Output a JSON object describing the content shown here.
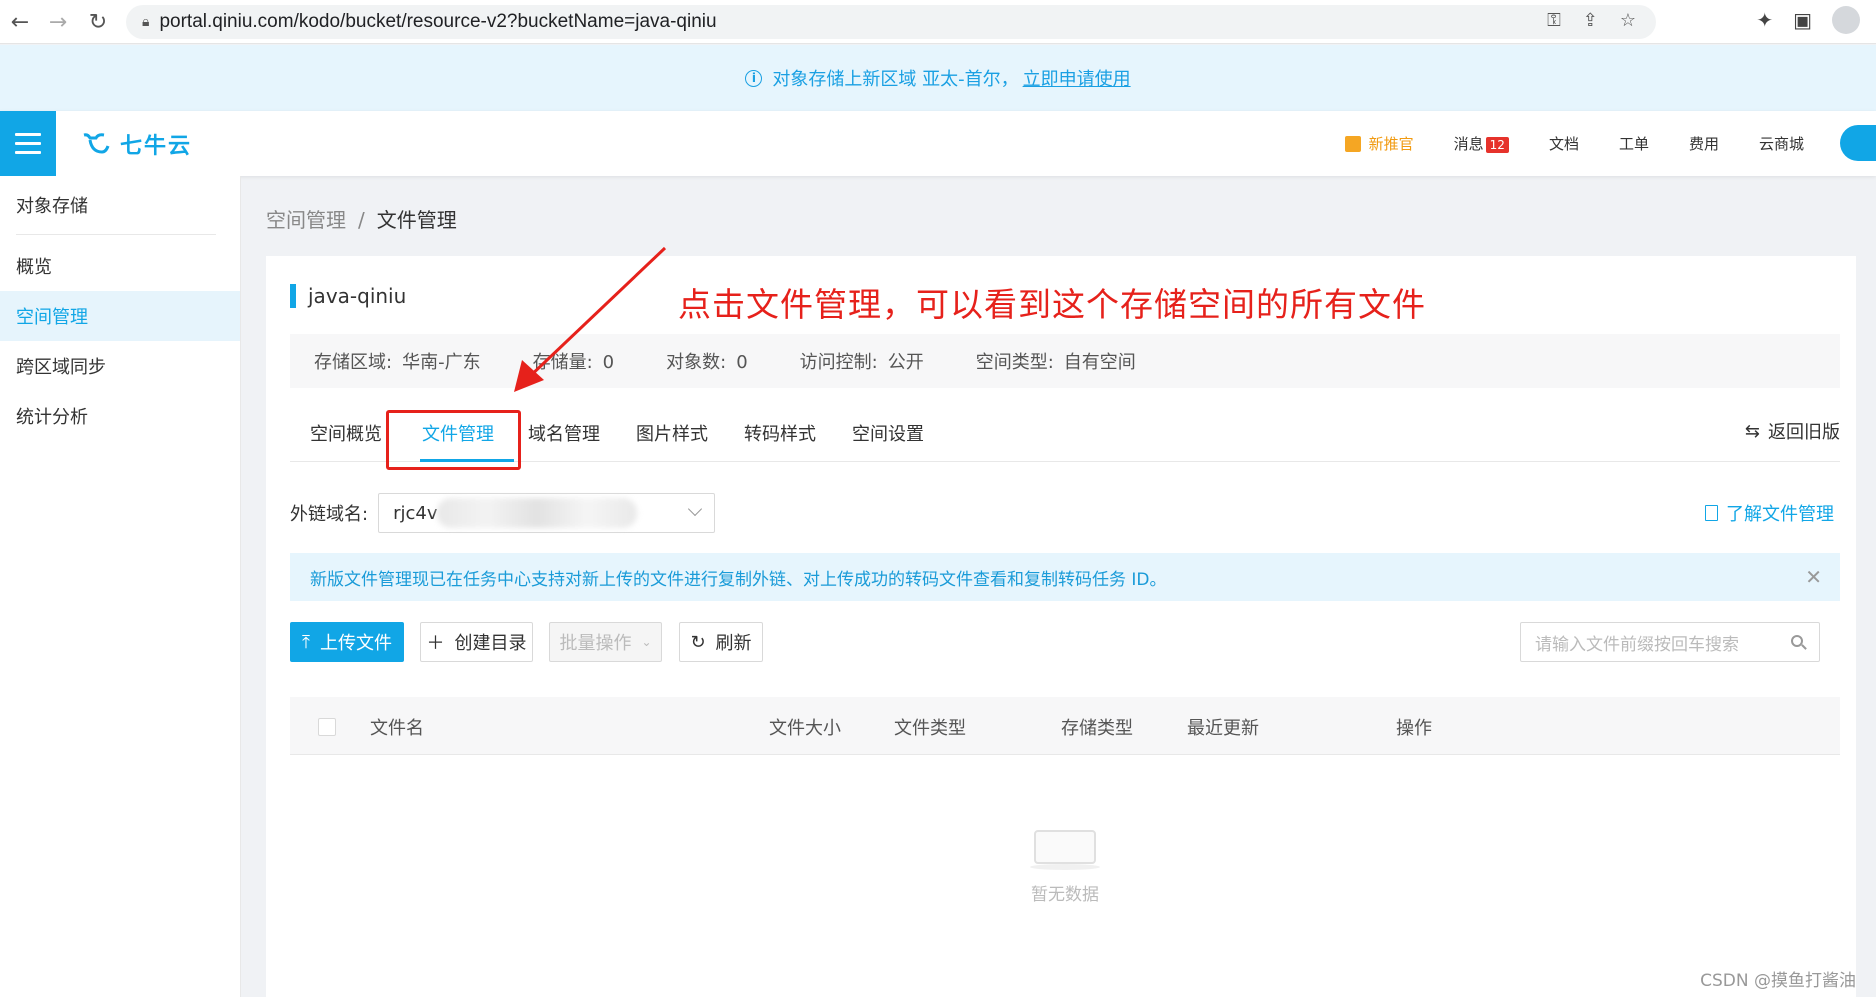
{
  "browser": {
    "url": "portal.qiniu.com/kodo/bucket/resource-v2?bucketName=java-qiniu"
  },
  "notice": {
    "text": "对象存储上新区域 亚太-首尔，",
    "link": "立即申请使用"
  },
  "header": {
    "logo": "七牛云",
    "nav": [
      "新推官",
      "消息",
      "文档",
      "工单",
      "费用",
      "云商城"
    ],
    "message_count": "12"
  },
  "sidebar": {
    "title": "对象存储",
    "items": [
      {
        "label": "概览",
        "active": false
      },
      {
        "label": "空间管理",
        "active": true
      },
      {
        "label": "跨区域同步",
        "active": false
      },
      {
        "label": "统计分析",
        "active": false
      }
    ]
  },
  "breadcrumb": {
    "parent": "空间管理",
    "separator": "/",
    "current": "文件管理"
  },
  "bucket": {
    "name": "java-qiniu",
    "region_label": "存储区域:",
    "region_value": "华南-广东",
    "storage_label": "存储量:",
    "storage_value": "0",
    "objects_label": "对象数:",
    "objects_value": "0",
    "access_label": "访问控制:",
    "access_value": "公开",
    "type_label": "空间类型:",
    "type_value": "自有空间"
  },
  "annotation": "点击文件管理，可以看到这个存储空间的所有文件",
  "tabs": [
    "空间概览",
    "文件管理",
    "域名管理",
    "图片样式",
    "转码样式",
    "空间设置"
  ],
  "active_tab": "文件管理",
  "back_old": "返回旧版",
  "domain": {
    "label": "外链域名:",
    "value": "rjc4v"
  },
  "learn_link": "了解文件管理",
  "tip": "新版文件管理现已在任务中心支持对新上传的文件进行复制外链、对上传成功的转码文件查看和复制转码任务 ID。",
  "toolbar": {
    "upload": "上传文件",
    "create_dir": "创建目录",
    "batch": "批量操作",
    "refresh": "刷新",
    "search_placeholder": "请输入文件前缀按回车搜索"
  },
  "table": {
    "columns": [
      "文件名",
      "文件大小",
      "文件类型",
      "存储类型",
      "最近更新",
      "操作"
    ]
  },
  "empty": "暂无数据",
  "watermark": "CSDN @摸鱼打酱油",
  "colors": {
    "accent": "#11a6e6",
    "annotation_red": "#e6211b",
    "banner_bg": "#e6f5fd"
  }
}
